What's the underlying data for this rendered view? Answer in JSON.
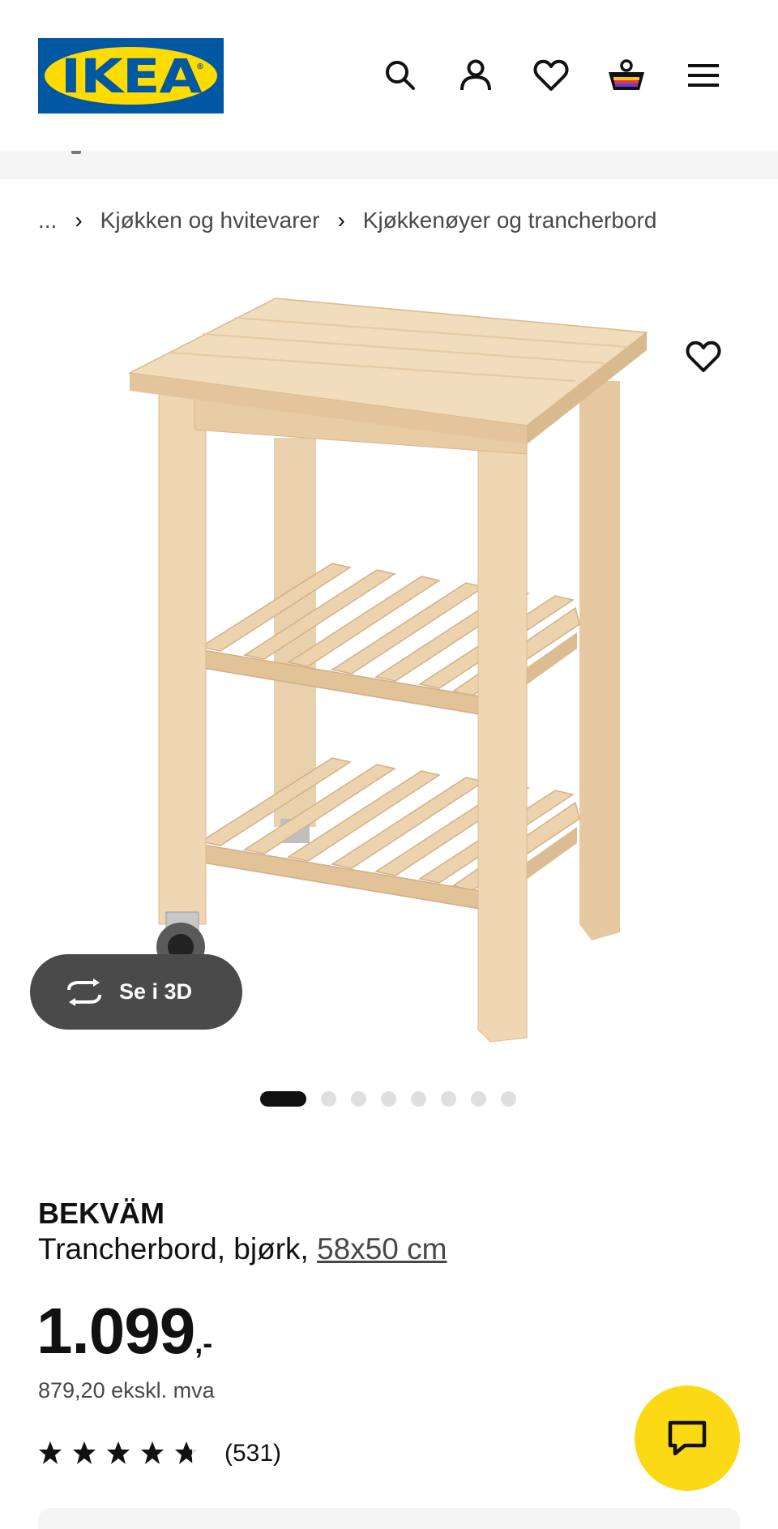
{
  "header": {
    "logo_text": "IKEA",
    "logo_mark": "®",
    "icons": [
      "search-icon",
      "user-icon",
      "heart-icon",
      "basket-icon",
      "menu-icon"
    ]
  },
  "breadcrumb": {
    "ellipsis": "...",
    "separator": "›",
    "items": [
      "Kjøkken og hvitevarer",
      "Kjøkkenøyer og trancherbord"
    ]
  },
  "gallery": {
    "see_3d_label": "Se i 3D",
    "slide_count": 8,
    "active_slide": 1
  },
  "product": {
    "name": "BEKVÄM",
    "description": "Trancherbord, bjørk, ",
    "size": "58x50 cm",
    "price_integer": "1.099",
    "price_decimal": ",-",
    "price_ex_vat": "879,20 ekskl. mva",
    "rating_value": 4.7,
    "rating_max": 5,
    "review_count": "(531)"
  },
  "colors": {
    "brand_blue": "#0058a3",
    "brand_yellow": "#ffdb00",
    "chat_yellow": "#fbd914",
    "dark_pill": "#4a4a4a"
  }
}
